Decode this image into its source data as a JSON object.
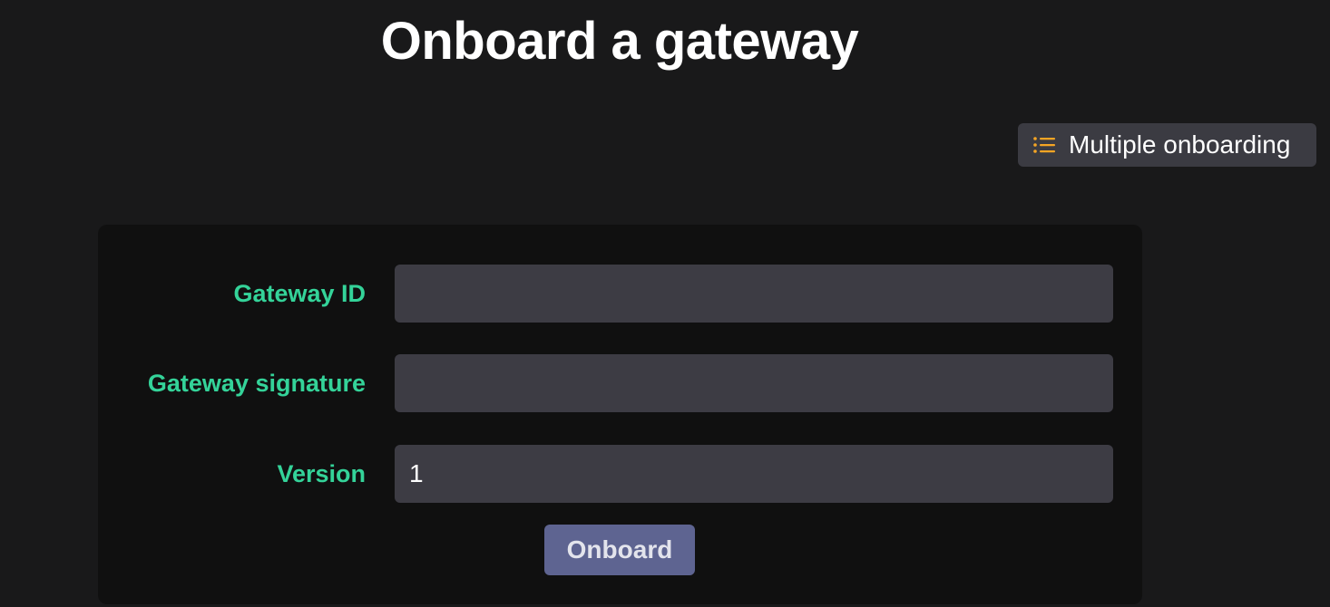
{
  "page": {
    "title": "Onboard a gateway"
  },
  "toolbar": {
    "multiple_onboarding_label": "Multiple onboarding",
    "multiple_onboarding_icon": "list-icon",
    "icon_color": "#f5a524"
  },
  "form": {
    "fields": [
      {
        "label": "Gateway ID",
        "value": "",
        "placeholder": ""
      },
      {
        "label": "Gateway signature",
        "value": "",
        "placeholder": ""
      },
      {
        "label": "Version",
        "value": "1",
        "placeholder": ""
      }
    ],
    "submit_label": "Onboard"
  },
  "colors": {
    "background": "#19191a",
    "card": "#101010",
    "input": "#3d3c44",
    "label": "#34d399",
    "button": "#5e6491"
  }
}
